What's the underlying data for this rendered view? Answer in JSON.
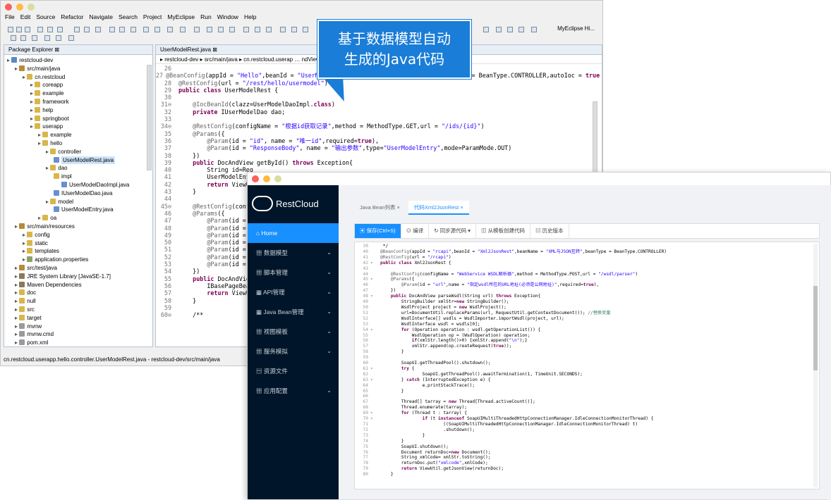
{
  "ide": {
    "menu": [
      "File",
      "Edit",
      "Source",
      "Refactor",
      "Navigate",
      "Search",
      "Project",
      "MyEclipse",
      "Run",
      "Window",
      "Help"
    ],
    "perspective": "MyEclipse Hi...",
    "pkg_tab": "Package Explorer ⊠",
    "editor_tab": "UserModelRest.java ⊠",
    "breadcrumb": "▸ restcloud-dev ▸ src/main/java ▸ cn.restcloud.userap …                                                     ndView",
    "tree": [
      {
        "label": "restcloud-dev",
        "indent": 0,
        "color": "#5b87c4"
      },
      {
        "label": "src/main/java",
        "indent": 1,
        "color": "#b58a3a"
      },
      {
        "label": "cn.restcloud",
        "indent": 2,
        "color": "#d8b64a"
      },
      {
        "label": "coreapp",
        "indent": 3,
        "color": "#d8b64a"
      },
      {
        "label": "example",
        "indent": 3,
        "color": "#d8b64a"
      },
      {
        "label": "framework",
        "indent": 3,
        "color": "#d8b64a"
      },
      {
        "label": "help",
        "indent": 3,
        "color": "#d8b64a"
      },
      {
        "label": "springboot",
        "indent": 3,
        "color": "#d8b64a"
      },
      {
        "label": "userapp",
        "indent": 3,
        "color": "#d8b64a"
      },
      {
        "label": "example",
        "indent": 4,
        "color": "#d8b64a"
      },
      {
        "label": "hello",
        "indent": 4,
        "color": "#d8b64a"
      },
      {
        "label": "controller",
        "indent": 5,
        "color": "#d8b64a"
      },
      {
        "label": "UserModelRest.java",
        "indent": 6,
        "color": "#6a8fd0",
        "selected": true
      },
      {
        "label": "dao",
        "indent": 5,
        "color": "#d8b64a"
      },
      {
        "label": "impl",
        "indent": 6,
        "color": "#d8b64a"
      },
      {
        "label": "UserModelDaoImpl.java",
        "indent": 7,
        "color": "#6a8fd0"
      },
      {
        "label": "IUserModelDao.java",
        "indent": 6,
        "color": "#6a8fd0"
      },
      {
        "label": "model",
        "indent": 5,
        "color": "#d8b64a"
      },
      {
        "label": "UserModelEntry.java",
        "indent": 6,
        "color": "#6a8fd0"
      },
      {
        "label": "oa",
        "indent": 4,
        "color": "#d8b64a"
      },
      {
        "label": "src/main/resources",
        "indent": 1,
        "color": "#b58a3a"
      },
      {
        "label": "config",
        "indent": 2,
        "color": "#d8b64a"
      },
      {
        "label": "static",
        "indent": 2,
        "color": "#d8b64a"
      },
      {
        "label": "templates",
        "indent": 2,
        "color": "#d8b64a"
      },
      {
        "label": "application.properties",
        "indent": 2,
        "color": "#8aa06a"
      },
      {
        "label": "src/test/java",
        "indent": 1,
        "color": "#b58a3a"
      },
      {
        "label": "JRE System Library [JavaSE-1.7]",
        "indent": 1,
        "color": "#8a7a5a"
      },
      {
        "label": "Maven Dependencies",
        "indent": 1,
        "color": "#8a7a5a"
      },
      {
        "label": "doc",
        "indent": 1,
        "color": "#d8b64a"
      },
      {
        "label": "null",
        "indent": 1,
        "color": "#d8b64a"
      },
      {
        "label": "src",
        "indent": 1,
        "color": "#d8b64a"
      },
      {
        "label": "target",
        "indent": 1,
        "color": "#d8b64a"
      },
      {
        "label": "mvnw",
        "indent": 1,
        "color": "#9a9a9a"
      },
      {
        "label": "mvnw.cmd",
        "indent": 1,
        "color": "#9a9a9a"
      },
      {
        "label": "pom.xml",
        "indent": 1,
        "color": "#9a9a9a"
      }
    ],
    "code": [
      {
        "n": "26",
        "t": ""
      },
      {
        "n": "27",
        "t": "@BeanConfig(appId = \"Hello\",beanId = \"UserModelRest\",beanName = \"用户数据模型\",beanType = BeanType.CONTROLLER,autoIoc = true"
      },
      {
        "n": "28",
        "t": "@RestConfig(url = \"/rest/hello/usermodel\")"
      },
      {
        "n": "29",
        "t": "public class UserModelRest {"
      },
      {
        "n": "30",
        "t": ""
      },
      {
        "n": "31⊖",
        "t": "    @IocBeanId(clazz=UserModelDaoImpl.class)"
      },
      {
        "n": "32",
        "t": "    private IUserModelDao dao;"
      },
      {
        "n": "33",
        "t": ""
      },
      {
        "n": "34⊖",
        "t": "    @RestConfig(configName = \"根据id获取记录\",method = MethodType.GET,url = \"/ids/{id}\")"
      },
      {
        "n": "35",
        "t": "    @Params({"
      },
      {
        "n": "36",
        "t": "        @Param(id = \"id\", name = \"唯一id\",required=true),"
      },
      {
        "n": "37",
        "t": "        @Param(id = \"ResponseBody\", name = \"输出参数\",type=\"UserModelEntry\",mode=ParamMode.OUT)"
      },
      {
        "n": "38",
        "t": "    })"
      },
      {
        "n": "39",
        "t": "    public DocAndView getById() throws Exception{"
      },
      {
        "n": "40",
        "t": "        String id=Req"
      },
      {
        "n": "41",
        "t": "        UserModelEntr"
      },
      {
        "n": "42",
        "t": "        return ViewUt"
      },
      {
        "n": "43",
        "t": "    }"
      },
      {
        "n": "44",
        "t": ""
      },
      {
        "n": "45⊖",
        "t": "    @RestConfig(confi"
      },
      {
        "n": "46",
        "t": "    @Params({"
      },
      {
        "n": "47",
        "t": "        @Param(id = \""
      },
      {
        "n": "48",
        "t": "        @Param(id = \""
      },
      {
        "n": "49",
        "t": "        @Param(id = \""
      },
      {
        "n": "50",
        "t": "        @Param(id = \""
      },
      {
        "n": "51",
        "t": "        @Param(id = \""
      },
      {
        "n": "52",
        "t": "        @Param(id = \""
      },
      {
        "n": "53",
        "t": "        @Param(id = \""
      },
      {
        "n": "54",
        "t": "    })"
      },
      {
        "n": "55",
        "t": "    public DocAndView"
      },
      {
        "n": "56",
        "t": "        IBasePageBean"
      },
      {
        "n": "57",
        "t": "        return ViewUt"
      },
      {
        "n": "58",
        "t": "    }"
      },
      {
        "n": "59",
        "t": ""
      },
      {
        "n": "60⊖",
        "t": "    /**"
      }
    ],
    "status": "cn.restcloud.userapp.hello.controller.UserModelRest.java - restcloud-dev/src/main/java"
  },
  "callout": {
    "line1": "基于数据模型自动",
    "line2": "生成的Java代码",
    "color": "#1a7dd7"
  },
  "rc": {
    "brand": "RestCloud",
    "nav": [
      {
        "label": "Home",
        "icon": "home-icon",
        "active": true,
        "arrow": false
      },
      {
        "label": "数据模型",
        "icon": "grid-icon",
        "arrow": true
      },
      {
        "label": "脚本管理",
        "icon": "grid-icon",
        "arrow": true
      },
      {
        "label": "API管理",
        "icon": "grid-icon",
        "arrow": true
      },
      {
        "label": "Java Bean管理",
        "icon": "grid-icon",
        "arrow": true
      },
      {
        "label": "视图模板",
        "icon": "grid-icon",
        "arrow": true
      },
      {
        "label": "服务模拟",
        "icon": "grid-icon",
        "arrow": true
      },
      {
        "label": "资源文件",
        "icon": "doc-icon",
        "arrow": false
      },
      {
        "label": "应用配置",
        "icon": "grid-icon",
        "arrow": true
      }
    ],
    "tabs": [
      {
        "label": "Java Bean列表 ×",
        "active": false
      },
      {
        "label": "代码Xml2JsonRest ×",
        "active": true
      }
    ],
    "buttons": [
      {
        "label": "保存(Ctrl+S)",
        "icon": "save-icon",
        "primary": true
      },
      {
        "label": "编译",
        "icon": "compile-icon"
      },
      {
        "label": "同步源代码 ▾",
        "icon": "sync-icon"
      },
      {
        "label": "从模板创建代码",
        "icon": "template-icon"
      },
      {
        "label": "历史版本",
        "icon": "history-icon"
      }
    ],
    "accent": "#1890ff",
    "sidebar_bg": "#001529",
    "code": [
      {
        "n": "39",
        "g": "",
        "t": " */"
      },
      {
        "n": "40",
        "g": "",
        "t": "@BeanConfig(appId = \"rcapi\",beanId = \"Xml2JsonRest\",beanName = \"XML与JSON互转\",beanType = BeanType.CONTROLLER)"
      },
      {
        "n": "41",
        "g": "",
        "t": "@RestConfig(url = \"/rcapi\")"
      },
      {
        "n": "42",
        "g": "▾",
        "t": "public class Xml2JsonRest {"
      },
      {
        "n": "43",
        "g": "",
        "t": ""
      },
      {
        "n": "44",
        "g": "",
        "t": "    @RestConfig(configName = \"WebService WSDL解析器\",method = MethodType.POST,url = \"/wsdl/parser\")"
      },
      {
        "n": "45",
        "g": "▾",
        "t": "    @Params({"
      },
      {
        "n": "46",
        "g": "",
        "t": "        @Param(id = \"url\",name = \"指定wsdl所在的URL地址(必须是公网地址)\",required=true),"
      },
      {
        "n": "47",
        "g": "",
        "t": "    })"
      },
      {
        "n": "48",
        "g": "▾",
        "t": "    public DocAndView parseWsdl(String url) throws Exception{"
      },
      {
        "n": "49",
        "g": "",
        "t": "        StringBuilder xmlStr=new StringBuilder();"
      },
      {
        "n": "50",
        "g": "",
        "t": "        WsdlProject project = new WsdlProject();"
      },
      {
        "n": "51",
        "g": "",
        "t": "        url=DocumentUtil.replaceParams(url, RequestUtil.getContextDocument()); //替换变量"
      },
      {
        "n": "52",
        "g": "",
        "t": "        WsdlInterface[] wsdls = WsdlImporter.importWsdl(project, url);"
      },
      {
        "n": "53",
        "g": "",
        "t": "        WsdlInterface wsdl = wsdls[0];"
      },
      {
        "n": "54",
        "g": "▾",
        "t": "        for (Operation operation : wsdl.getOperationList()) {"
      },
      {
        "n": "55",
        "g": "",
        "t": "            WsdlOperation op = (WsdlOperation) operation;"
      },
      {
        "n": "56",
        "g": "",
        "t": "            if(xmlStr.length()>0) {xmlStr.append(\"\\n\");}"
      },
      {
        "n": "57",
        "g": "",
        "t": "            xmlStr.append(op.createRequest(true));"
      },
      {
        "n": "58",
        "g": "",
        "t": "        }"
      },
      {
        "n": "59",
        "g": "",
        "t": ""
      },
      {
        "n": "60",
        "g": "",
        "t": "        SoapUI.getThreadPool().shutdown();"
      },
      {
        "n": "61",
        "g": "▾",
        "t": "        try {"
      },
      {
        "n": "62",
        "g": "",
        "t": "                SoapUI.getThreadPool().awaitTermination(1, TimeUnit.SECONDS);"
      },
      {
        "n": "63",
        "g": "▾",
        "t": "        } catch (InterruptedException e) {"
      },
      {
        "n": "64",
        "g": "",
        "t": "                e.printStackTrace();"
      },
      {
        "n": "65",
        "g": "",
        "t": "        }"
      },
      {
        "n": "66",
        "g": "",
        "t": ""
      },
      {
        "n": "67",
        "g": "",
        "t": "        Thread[] tarray = new Thread[Thread.activeCount()];"
      },
      {
        "n": "68",
        "g": "",
        "t": "        Thread.enumerate(tarray);"
      },
      {
        "n": "69",
        "g": "▾",
        "t": "        for (Thread t : tarray) {"
      },
      {
        "n": "70",
        "g": "▾",
        "t": "                if (t instanceof SoapUIMultiThreadedHttpConnectionManager.IdleConnectionMonitorThread) {"
      },
      {
        "n": "71",
        "g": "",
        "t": "                        ((SoapUIMultiThreadedHttpConnectionManager.IdleConnectionMonitorThread) t)"
      },
      {
        "n": "72",
        "g": "",
        "t": "                        .shutdown();"
      },
      {
        "n": "73",
        "g": "",
        "t": "                }"
      },
      {
        "n": "74",
        "g": "",
        "t": "        }"
      },
      {
        "n": "75",
        "g": "",
        "t": "        SoapUI.shutdown();"
      },
      {
        "n": "76",
        "g": "",
        "t": "        Document returnDoc=new Document();"
      },
      {
        "n": "77",
        "g": "",
        "t": "        String xmlCode= xmlStr.toString();"
      },
      {
        "n": "78",
        "g": "",
        "t": "        returnDoc.put(\"xmlcode\",xmlCode);"
      },
      {
        "n": "79",
        "g": "",
        "t": "        return ViewUtil.getJsonView(returnDoc);"
      },
      {
        "n": "80",
        "g": "",
        "t": "    }"
      }
    ]
  }
}
